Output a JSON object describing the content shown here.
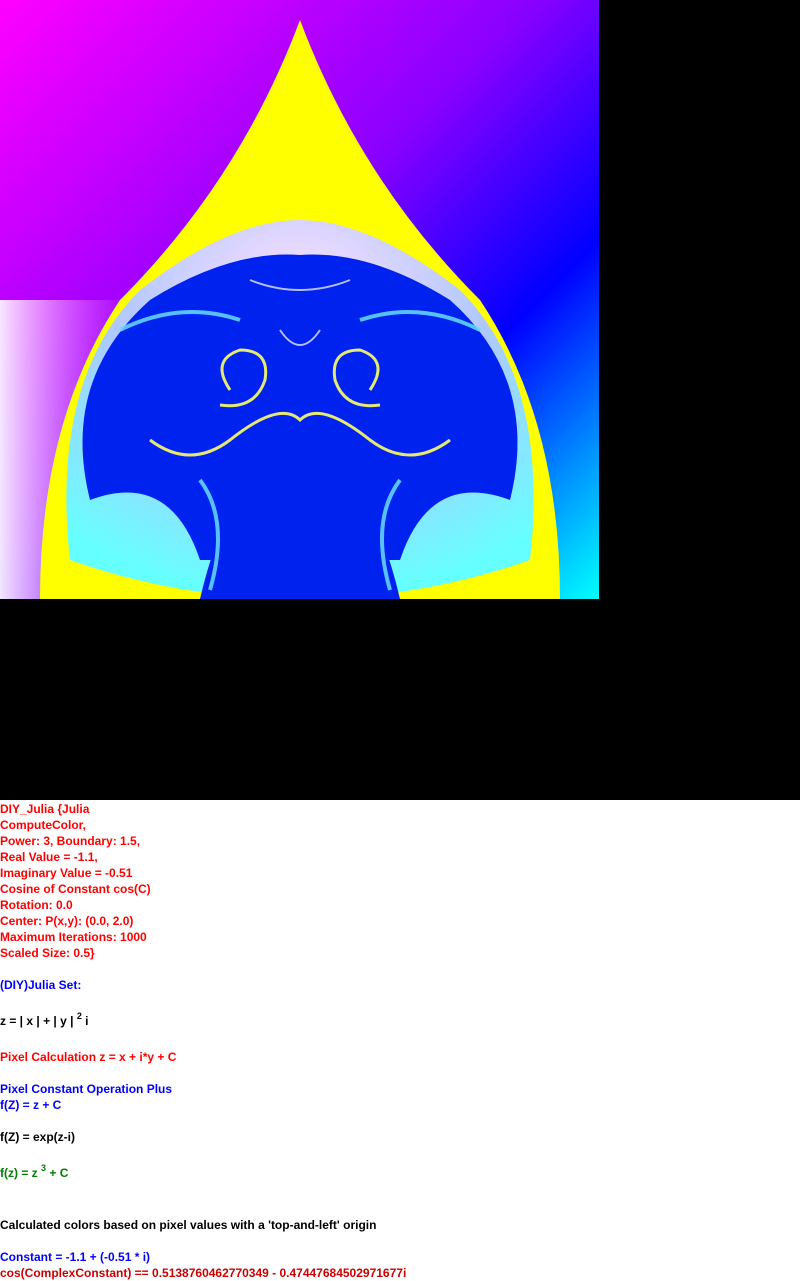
{
  "info": {
    "params": [
      "DIY_Julia {Julia",
      "ComputeColor,",
      "Power: 3, Boundary: 1.5,",
      "Real Value = -1.1,",
      "Imaginary Value = -0.51",
      "Cosine of Constant cos(C)",
      "Rotation: 0.0",
      "Center: P(x,y): (0.0, 2.0)",
      "Maximum Iterations: 1000",
      "Scaled Size: 0.5}"
    ],
    "set_title": "(DIY)Julia Set:",
    "formula_main": "z = | x | + | y |",
    "formula_exp": "2",
    "formula_tail": " i",
    "pixel_calc": "Pixel Calculation z = x + i*y + C",
    "const_op": "Pixel Constant Operation Plus",
    "fz_plus": "f(Z) = z + C",
    "fz_exp": "f(Z) = exp(z-i)",
    "fz_pow_a": "f(z) = z",
    "fz_pow_exp": "3",
    "fz_pow_b": " + C",
    "colors_note": "Calculated colors based on pixel values with a 'top-and-left' origin",
    "constant": "Constant = -1.1 + (-0.51 * i)",
    "cos_constant": "cos(ComplexConstant) == 0.5138760462770349 - 0.47447684502971677i"
  }
}
